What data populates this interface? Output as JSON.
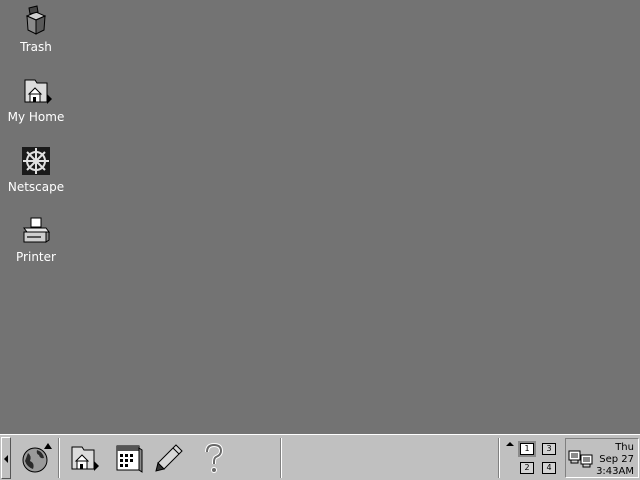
{
  "desktop": {
    "icons": [
      {
        "label": "Trash",
        "icon": "trash-icon"
      },
      {
        "label": "My Home",
        "icon": "home-folder-icon"
      },
      {
        "label": "Netscape",
        "icon": "netscape-wheel-icon"
      },
      {
        "label": "Printer",
        "icon": "printer-icon"
      }
    ]
  },
  "taskbar": {
    "launchers": [
      {
        "icon": "globe-menu-icon"
      },
      {
        "icon": "home-folder-icon"
      },
      {
        "icon": "calendar-icon"
      },
      {
        "icon": "pen-icon"
      },
      {
        "icon": "help-icon"
      }
    ],
    "pager": {
      "desktops": [
        "1",
        "2",
        "3",
        "4"
      ],
      "active": "1"
    },
    "clock": {
      "day": "Thu",
      "date": "Sep 27",
      "time": "3:43AM"
    }
  },
  "colors": {
    "desktop_bg": "#737373",
    "taskbar_bg": "#c0c0c0",
    "label_text": "#ffffff"
  }
}
